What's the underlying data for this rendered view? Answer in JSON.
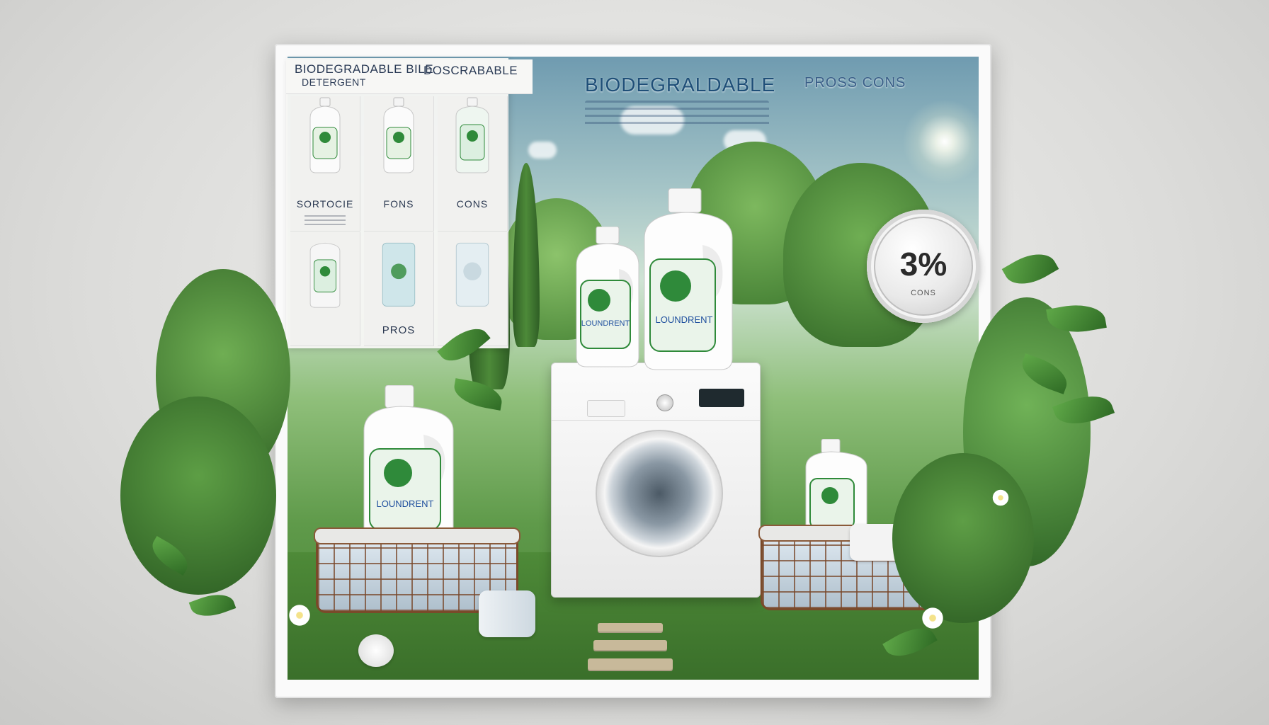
{
  "headline": {
    "main": "BIODEGRALDABLE",
    "secondary": "PROSS CONS"
  },
  "comparison_panel": {
    "title_left_line1": "BIODEGRADABLE BILE",
    "title_left_line2": "DETERGENT",
    "title_right": "DOSCRABABLE",
    "row1_labels": [
      "SORTOCIE",
      "FONS",
      "CONS"
    ],
    "row2_labels": [
      "",
      "PROS",
      ""
    ]
  },
  "badge": {
    "value": "3%",
    "small_text": "CONS"
  },
  "bottle_label": "LOUNDRENT",
  "colors": {
    "accent_green": "#2f8a3a",
    "label_blue": "#1f4f9e",
    "sky": "#6f9bb0",
    "frame": "#fafafa"
  }
}
